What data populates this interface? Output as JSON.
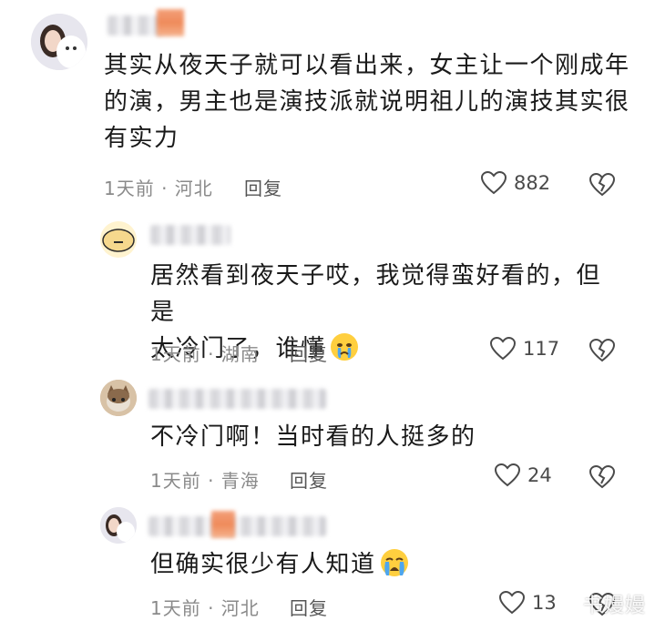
{
  "comments": [
    {
      "text": "其实从夜天子就可以看出来，女主让一个刚成年的演，男主也是演技派就说明祖儿的演技其实很有实力",
      "line1": "其实从夜天子就可以看出来，女主让一个刚成年",
      "line2": "的演，男主也是演技派就说明祖儿的演技其实很",
      "line3": "有实力",
      "time_location": "1天前 · 河北",
      "reply_label": "回复",
      "likes": "882"
    },
    {
      "line1": "居然看到夜天子哎，我觉得蛮好看的，但是",
      "line2": "太冷门了，谁懂",
      "emoji": "crying-face",
      "time_location": "1天前 · 湖南",
      "reply_label": "回复",
      "likes": "117"
    },
    {
      "line1": "不冷门啊！当时看的人挺多的",
      "time_location": "1天前 · 青海",
      "reply_label": "回复",
      "likes": "24"
    },
    {
      "line1": "但确实很少有人知道",
      "emoji": "loudly-crying-face",
      "time_location": "1天前 · 河北",
      "reply_label": "回复",
      "likes": "13"
    }
  ],
  "icons": {
    "like": "heart-outline-icon",
    "dislike": "broken-heart-icon"
  },
  "watermark": "书嫚嫚"
}
